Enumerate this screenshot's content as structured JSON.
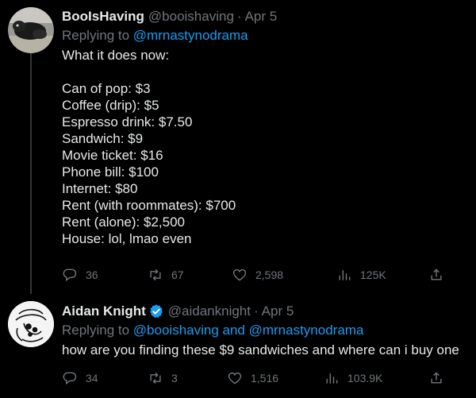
{
  "tweets": [
    {
      "name": "BooIsHaving",
      "handle": "@booishaving",
      "separator": "·",
      "date": "Apr 5",
      "replying_prefix": "Replying to",
      "replying_to": "@mrnastynodrama",
      "lines": [
        "What it does now:",
        "",
        "Can of pop: $3",
        "Coffee (drip): $5",
        "Espresso drink: $7.50",
        "Sandwich: $9",
        "Movie ticket: $16",
        "Phone bill: $100",
        "Internet: $80",
        "Rent (with roommates): $700",
        "Rent (alone): $2,500",
        "House: lol, lmao even"
      ],
      "stats": {
        "replies": "36",
        "retweets": "67",
        "likes": "2,598",
        "views": "125K"
      }
    },
    {
      "name": "Aidan Knight",
      "verified": true,
      "handle": "@aidanknight",
      "separator": "·",
      "date": "Apr 5",
      "replying_prefix": "Replying to",
      "replying_to": "@booishaving and @mrnastynodrama",
      "text": "how are you finding these $9 sandwiches and where can i buy one",
      "stats": {
        "replies": "34",
        "retweets": "3",
        "likes": "1,516",
        "views": "103.9K"
      }
    }
  ],
  "colors": {
    "background": "#000000",
    "text": "#e7e9ea",
    "muted": "#71767b",
    "link": "#1d9bf0"
  }
}
